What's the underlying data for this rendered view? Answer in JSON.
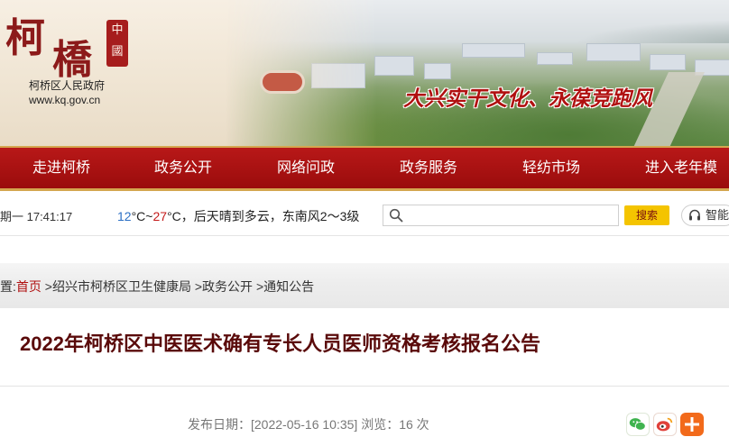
{
  "header": {
    "logo_char_1": "柯",
    "logo_char_2": "橋",
    "logo_seal": "中國",
    "org_name": "柯桥区人民政府",
    "url": "www.kq.gov.cn",
    "slogan": "大兴实干文化、永葆竞跑风"
  },
  "nav": {
    "items": [
      {
        "label": "走进柯桥"
      },
      {
        "label": "政务公开"
      },
      {
        "label": "网络问政"
      },
      {
        "label": "政务服务"
      },
      {
        "label": "轻纺市场"
      },
      {
        "label": "进入老年模"
      }
    ]
  },
  "infobar": {
    "datetime": "期一 17:41:17",
    "weather": {
      "low": "12",
      "high": "27",
      "unit": "°C",
      "sep": "~",
      "text": "，后天晴到多云，东南风2～3级"
    },
    "search_placeholder": "",
    "search_button": "搜索",
    "assistant_label": "智能"
  },
  "breadcrumb": {
    "prefix": "置:",
    "home": "首页",
    "items": [
      "绍兴市柯桥区卫生健康局",
      "政务公开",
      "通知公告"
    ],
    "separator": ">"
  },
  "article": {
    "title": "2022年柯桥区中医医术确有专长人员医师资格考核报名公告",
    "meta_label_date": "发布日期：",
    "date": "[2022-05-16 10:35]",
    "meta_label_views": "浏览：",
    "views": "16 次"
  },
  "share": {
    "icons": [
      "wechat-icon",
      "weibo-icon",
      "more-share-icon"
    ]
  },
  "colors": {
    "nav_red": "#a61212",
    "gold": "#d4a64f",
    "title_dark_red": "#5a0a0a",
    "search_yellow": "#f4c400"
  }
}
